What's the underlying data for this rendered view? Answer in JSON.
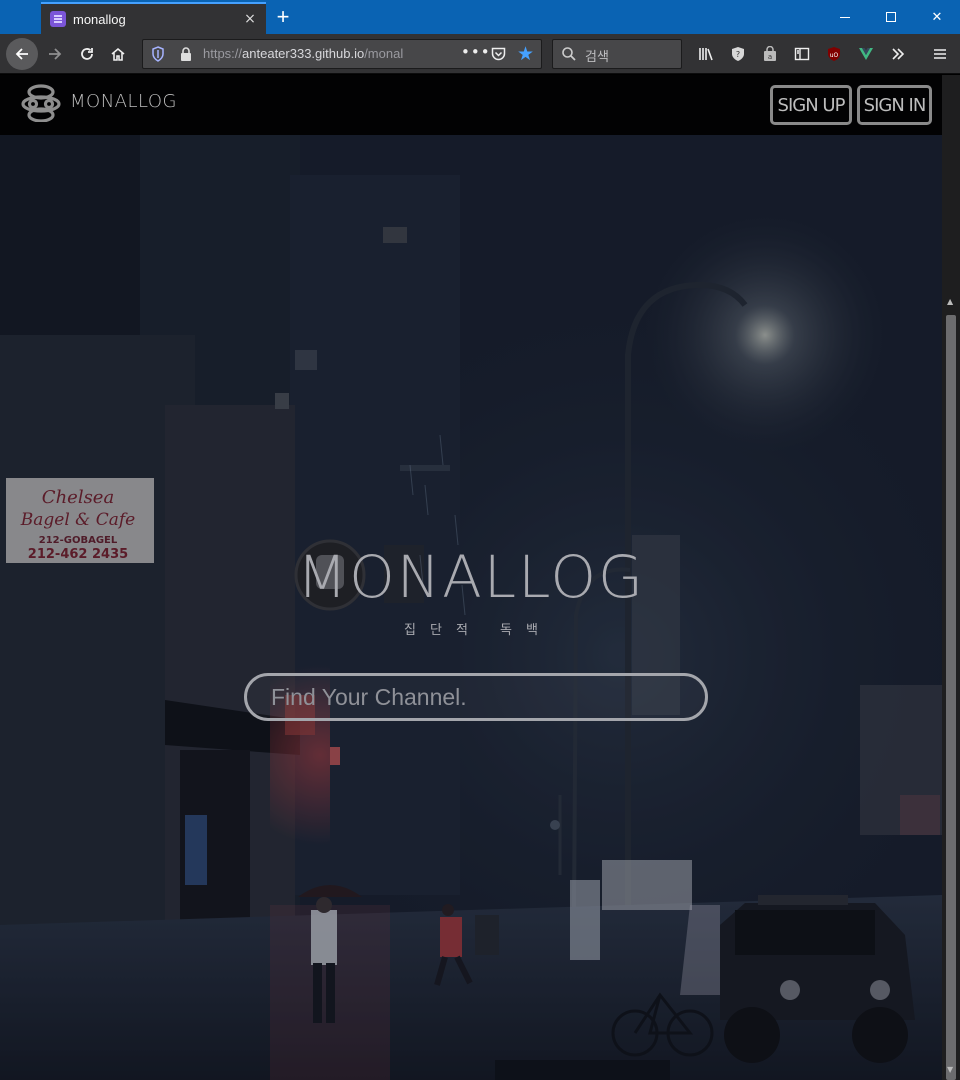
{
  "browser": {
    "tab": {
      "title": "monallog",
      "favicon": "page-icon",
      "close": "×"
    },
    "new_tab": "+",
    "window_controls": {
      "minimize": "minimize-icon",
      "maximize": "maximize-icon",
      "close": "close-icon"
    },
    "url": {
      "host_prefix": "https://",
      "host": "anteater333.github.io",
      "path": "/monal"
    },
    "url_more": "•••",
    "search_placeholder": "검색",
    "accent_color": "#45a1ff",
    "titlebar_color": "#0a63b3"
  },
  "site": {
    "brand": "MONALLOG",
    "nav": {
      "signup": "SIGN UP",
      "signin": "SIGN IN"
    },
    "hero": {
      "title": "MONALLOG",
      "tagline": "집단적 독백",
      "search_placeholder": "Find Your Channel."
    },
    "sign": {
      "line1": "Chelsea",
      "line2": "Bagel & Cafe",
      "line3": "212-GOBAGEL",
      "line4": "212-462 2435"
    }
  }
}
